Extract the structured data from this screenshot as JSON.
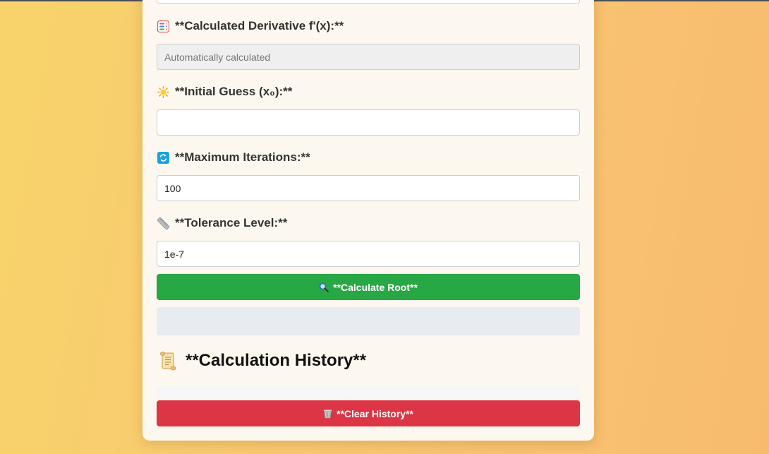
{
  "form": {
    "derivative": {
      "label": "**Calculated Derivative f'(x):**",
      "icon": "abacus-icon",
      "placeholder": "Automatically calculated",
      "value": ""
    },
    "initial_guess": {
      "label": "**Initial Guess (x₀):**",
      "icon": "sun-icon",
      "value": ""
    },
    "max_iterations": {
      "label": "**Maximum Iterations:**",
      "icon": "repeat-icon",
      "value": "100"
    },
    "tolerance": {
      "label": "**Tolerance Level:**",
      "icon": "ruler-icon",
      "value": "1e-7"
    },
    "calculate_button": {
      "label": "**Calculate Root**",
      "icon": "magnifier-icon",
      "color": "#28a745"
    }
  },
  "result": {
    "text": ""
  },
  "history": {
    "title": "**Calculation History**",
    "icon": "scroll-icon",
    "clear_button": {
      "label": "**Clear History**",
      "icon": "wastebasket-icon",
      "color": "#dc3545"
    }
  },
  "theme": {
    "background_start": "#f8d36a",
    "background_end": "#f8bb6e",
    "card": "#fdf8ef"
  }
}
